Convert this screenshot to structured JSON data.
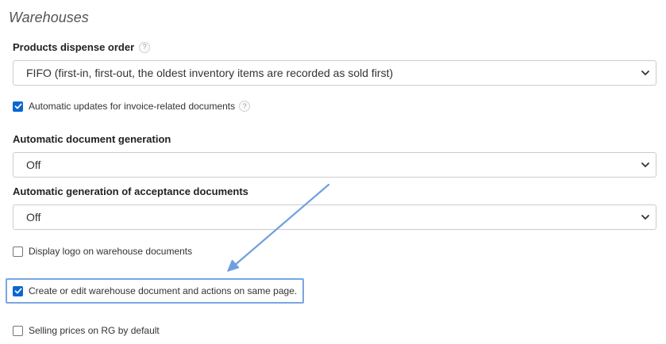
{
  "section": {
    "title": "Warehouses"
  },
  "dispense_order": {
    "label": "Products dispense order",
    "help": "?",
    "selected": "FIFO (first-in, first-out, the oldest inventory items are recorded as sold first)"
  },
  "auto_updates": {
    "label": "Automatic updates for invoice-related documents",
    "help": "?",
    "checked": true
  },
  "auto_doc_generation": {
    "label": "Automatic document generation",
    "selected": "Off"
  },
  "auto_acceptance_generation": {
    "label": "Automatic generation of acceptance documents",
    "selected": "Off"
  },
  "display_logo": {
    "label": "Display logo on warehouse documents",
    "checked": false
  },
  "same_page_edit": {
    "label": "Create or edit warehouse document and actions on same page.",
    "checked": true
  },
  "selling_prices": {
    "label": "Selling prices on RG by default",
    "checked": false
  },
  "colors": {
    "checkbox_accent": "#0b67d0",
    "highlight": "#7aa6e2",
    "arrow": "#6f9fe0"
  },
  "icons": {
    "help": "question-circle-icon",
    "dropdown": "chevron-down-icon",
    "check": "checkmark-icon",
    "annotation": "arrow-annotation"
  }
}
